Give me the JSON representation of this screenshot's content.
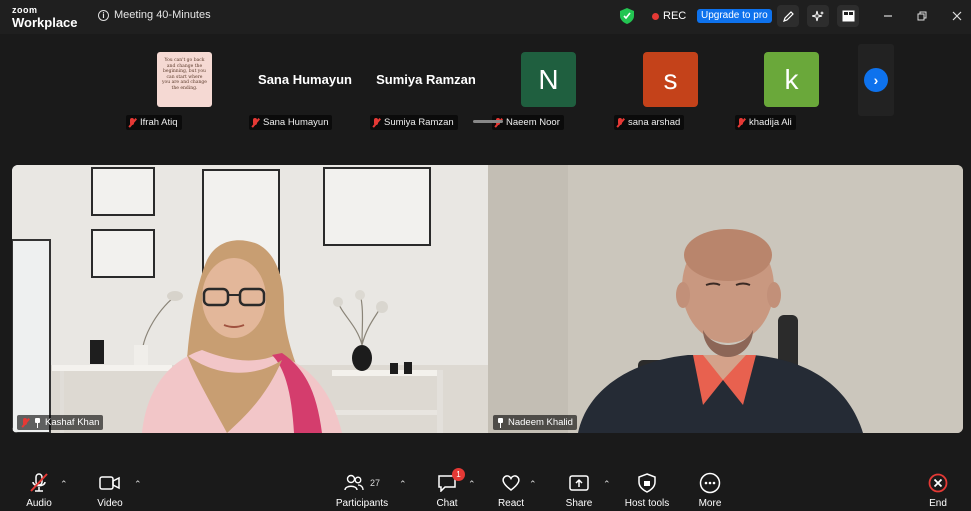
{
  "titlebar": {
    "logo_line1": "zoom",
    "logo_line2": "Workplace",
    "meeting_title": "Meeting 40-Minutes",
    "rec_label": "REC",
    "upgrade_label": "Upgrade to pro"
  },
  "strip": {
    "quote_text": "You can't go back and change the beginning, but you can start where you are and change the ending.",
    "participants": [
      {
        "label": "Ifrah Atiq",
        "display": "image",
        "muted": true
      },
      {
        "label": "Sana Humayun",
        "display": "Sana Humayun",
        "muted": true
      },
      {
        "label": "Sumiya Ramzan",
        "display": "Sumiya Ramzan",
        "muted": true
      },
      {
        "label": "Naeem Noor",
        "display": "N",
        "color": "#1f5f3f",
        "muted": true
      },
      {
        "label": "sana arshad",
        "display": "s",
        "color": "#c4421a",
        "muted": true
      },
      {
        "label": "khadija Ali",
        "display": "k",
        "color": "#6aa83a",
        "muted": true
      }
    ]
  },
  "videos": {
    "left_name": "Kashaf Khan",
    "right_name": "Nadeem Khalid"
  },
  "toolbar": {
    "audio": "Audio",
    "video": "Video",
    "participants": "Participants",
    "participants_count": "27",
    "chat": "Chat",
    "chat_badge": "1",
    "react": "React",
    "share": "Share",
    "host_tools": "Host tools",
    "more": "More",
    "end": "End"
  },
  "colors": {
    "accent": "#0e72ed",
    "danger": "#e53935",
    "background": "#1a1a1a"
  }
}
